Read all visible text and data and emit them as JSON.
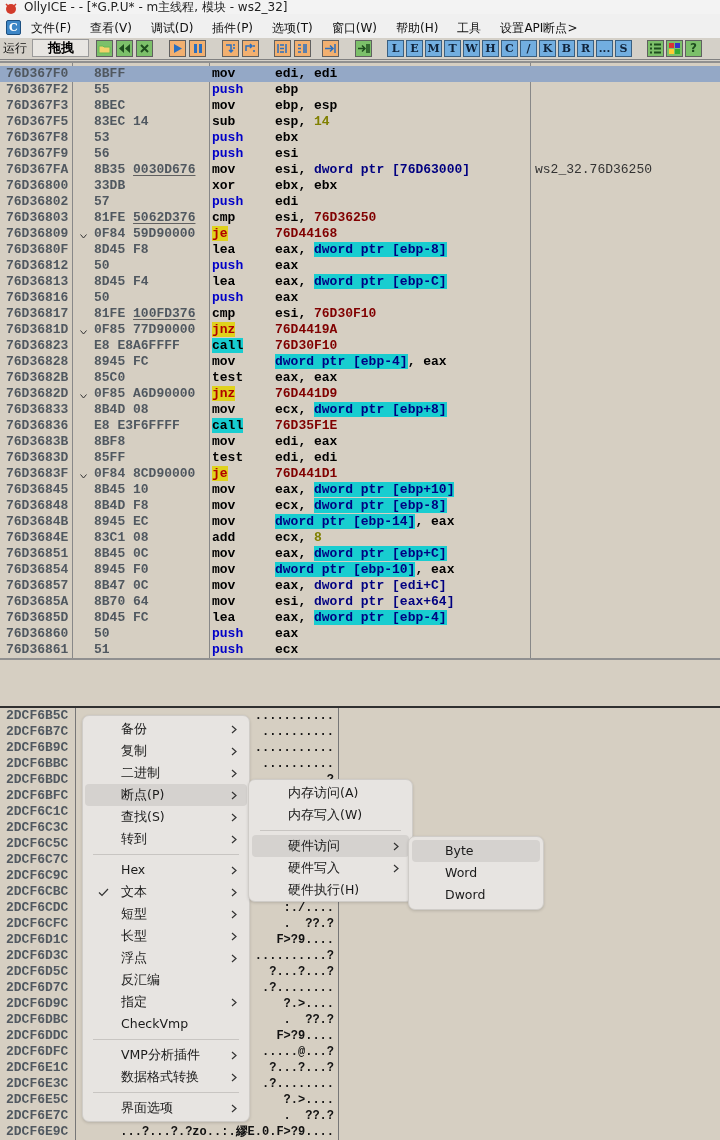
{
  "window": {
    "title": "OllyICE - - [*G.P.U* - m主线程, 模块 - ws2_32]"
  },
  "menubar": {
    "logo": "C",
    "items": [
      "文件(F)",
      "查看(V)",
      "调试(D)",
      "插件(P)",
      "选项(T)",
      "窗口(W)",
      "帮助(H)",
      "工具",
      "设置API断点>"
    ]
  },
  "toolbar": {
    "label": "运行",
    "field": "拖拽",
    "letter_buttons": [
      "L",
      "E",
      "M",
      "T",
      "W",
      "H",
      "C",
      "/",
      "K",
      "B",
      "R",
      "...",
      "S"
    ],
    "help_button": "?"
  },
  "disasm": {
    "rows": [
      {
        "address": "76D367F0",
        "hex": "8BFF",
        "jump": false,
        "selected": true,
        "mnemonic": "mov",
        "kind": "plain",
        "operands": [
          {
            "text": "edi",
            "kind": "reg"
          },
          {
            "text": ", ",
            "kind": "sep"
          },
          {
            "text": "edi",
            "kind": "reg"
          }
        ]
      },
      {
        "address": "76D367F2",
        "hex": "55",
        "jump": false,
        "selected": false,
        "mnemonic": "push",
        "kind": "push",
        "operands": [
          {
            "text": "ebp",
            "kind": "reg"
          }
        ]
      },
      {
        "address": "76D367F3",
        "hex": "8BEC",
        "jump": false,
        "selected": false,
        "mnemonic": "mov",
        "kind": "plain",
        "operands": [
          {
            "text": "ebp",
            "kind": "reg"
          },
          {
            "text": ", ",
            "kind": "sep"
          },
          {
            "text": "esp",
            "kind": "reg"
          }
        ]
      },
      {
        "address": "76D367F5",
        "hex": "83EC 14",
        "jump": false,
        "selected": false,
        "mnemonic": "sub",
        "kind": "plain",
        "operands": [
          {
            "text": "esp",
            "kind": "reg"
          },
          {
            "text": ", ",
            "kind": "sep"
          },
          {
            "text": "14",
            "kind": "imm"
          }
        ]
      },
      {
        "address": "76D367F8",
        "hex": "53",
        "jump": false,
        "selected": false,
        "mnemonic": "push",
        "kind": "push",
        "operands": [
          {
            "text": "ebx",
            "kind": "reg"
          }
        ]
      },
      {
        "address": "76D367F9",
        "hex": "56",
        "jump": false,
        "selected": false,
        "mnemonic": "push",
        "kind": "push",
        "operands": [
          {
            "text": "esi",
            "kind": "reg"
          }
        ]
      },
      {
        "address": "76D367FA",
        "hex": "8B35",
        "hex_fixup": "0030D676",
        "jump": false,
        "selected": false,
        "mnemonic": "mov",
        "kind": "plain",
        "operands": [
          {
            "text": "esi",
            "kind": "reg"
          },
          {
            "text": ", ",
            "kind": "sep"
          },
          {
            "text": "dword ptr [76D63000]",
            "kind": "mem"
          }
        ],
        "comment": "ws2_32.76D36250"
      },
      {
        "address": "76D36800",
        "hex": "33DB",
        "jump": false,
        "selected": false,
        "mnemonic": "xor",
        "kind": "plain",
        "operands": [
          {
            "text": "ebx",
            "kind": "reg"
          },
          {
            "text": ", ",
            "kind": "sep"
          },
          {
            "text": "ebx",
            "kind": "reg"
          }
        ]
      },
      {
        "address": "76D36802",
        "hex": "57",
        "jump": false,
        "selected": false,
        "mnemonic": "push",
        "kind": "push",
        "operands": [
          {
            "text": "edi",
            "kind": "reg"
          }
        ]
      },
      {
        "address": "76D36803",
        "hex": "81FE",
        "hex_fixup": "5062D376",
        "jump": false,
        "selected": false,
        "mnemonic": "cmp",
        "kind": "plain",
        "operands": [
          {
            "text": "esi",
            "kind": "reg"
          },
          {
            "text": ", ",
            "kind": "sep"
          },
          {
            "text": "76D36250",
            "kind": "addr"
          }
        ]
      },
      {
        "address": "76D36809",
        "hex": "0F84 59D90000",
        "jump": true,
        "selected": false,
        "mnemonic": "je",
        "kind": "jump",
        "operands": [
          {
            "text": "76D44168",
            "kind": "addr"
          }
        ]
      },
      {
        "address": "76D3680F",
        "hex": "8D45 F8",
        "jump": false,
        "selected": false,
        "mnemonic": "lea",
        "kind": "plain",
        "operands": [
          {
            "text": "eax",
            "kind": "reg"
          },
          {
            "text": ", ",
            "kind": "sep"
          },
          {
            "text": "dword ptr [ebp-8]",
            "kind": "stack"
          }
        ]
      },
      {
        "address": "76D36812",
        "hex": "50",
        "jump": false,
        "selected": false,
        "mnemonic": "push",
        "kind": "push",
        "operands": [
          {
            "text": "eax",
            "kind": "reg"
          }
        ]
      },
      {
        "address": "76D36813",
        "hex": "8D45 F4",
        "jump": false,
        "selected": false,
        "mnemonic": "lea",
        "kind": "plain",
        "operands": [
          {
            "text": "eax",
            "kind": "reg"
          },
          {
            "text": ", ",
            "kind": "sep"
          },
          {
            "text": "dword ptr [ebp-C]",
            "kind": "stack"
          }
        ]
      },
      {
        "address": "76D36816",
        "hex": "50",
        "jump": false,
        "selected": false,
        "mnemonic": "push",
        "kind": "push",
        "operands": [
          {
            "text": "eax",
            "kind": "reg"
          }
        ]
      },
      {
        "address": "76D36817",
        "hex": "81FE",
        "hex_fixup": "100FD376",
        "jump": false,
        "selected": false,
        "mnemonic": "cmp",
        "kind": "plain",
        "operands": [
          {
            "text": "esi",
            "kind": "reg"
          },
          {
            "text": ", ",
            "kind": "sep"
          },
          {
            "text": "76D30F10",
            "kind": "addr"
          }
        ]
      },
      {
        "address": "76D3681D",
        "hex": "0F85 77D90000",
        "jump": true,
        "selected": false,
        "mnemonic": "jnz",
        "kind": "jump",
        "operands": [
          {
            "text": "76D4419A",
            "kind": "addr"
          }
        ]
      },
      {
        "address": "76D36823",
        "hex": "E8 E8A6FFFF",
        "jump": false,
        "selected": false,
        "mnemonic": "call",
        "kind": "call",
        "operands": [
          {
            "text": "76D30F10",
            "kind": "addr"
          }
        ]
      },
      {
        "address": "76D36828",
        "hex": "8945 FC",
        "jump": false,
        "selected": false,
        "mnemonic": "mov",
        "kind": "plain",
        "operands": [
          {
            "text": "dword ptr [ebp-4]",
            "kind": "stack"
          },
          {
            "text": ", ",
            "kind": "sep"
          },
          {
            "text": "eax",
            "kind": "reg"
          }
        ]
      },
      {
        "address": "76D3682B",
        "hex": "85C0",
        "jump": false,
        "selected": false,
        "mnemonic": "test",
        "kind": "plain",
        "operands": [
          {
            "text": "eax",
            "kind": "reg"
          },
          {
            "text": ", ",
            "kind": "sep"
          },
          {
            "text": "eax",
            "kind": "reg"
          }
        ]
      },
      {
        "address": "76D3682D",
        "hex": "0F85 A6D90000",
        "jump": true,
        "selected": false,
        "mnemonic": "jnz",
        "kind": "jump",
        "operands": [
          {
            "text": "76D441D9",
            "kind": "addr"
          }
        ]
      },
      {
        "address": "76D36833",
        "hex": "8B4D 08",
        "jump": false,
        "selected": false,
        "mnemonic": "mov",
        "kind": "plain",
        "operands": [
          {
            "text": "ecx",
            "kind": "reg"
          },
          {
            "text": ", ",
            "kind": "sep"
          },
          {
            "text": "dword ptr [ebp+8]",
            "kind": "stack"
          }
        ]
      },
      {
        "address": "76D36836",
        "hex": "E8 E3F6FFFF",
        "jump": false,
        "selected": false,
        "mnemonic": "call",
        "kind": "call",
        "operands": [
          {
            "text": "76D35F1E",
            "kind": "addr"
          }
        ]
      },
      {
        "address": "76D3683B",
        "hex": "8BF8",
        "jump": false,
        "selected": false,
        "mnemonic": "mov",
        "kind": "plain",
        "operands": [
          {
            "text": "edi",
            "kind": "reg"
          },
          {
            "text": ", ",
            "kind": "sep"
          },
          {
            "text": "eax",
            "kind": "reg"
          }
        ]
      },
      {
        "address": "76D3683D",
        "hex": "85FF",
        "jump": false,
        "selected": false,
        "mnemonic": "test",
        "kind": "plain",
        "operands": [
          {
            "text": "edi",
            "kind": "reg"
          },
          {
            "text": ", ",
            "kind": "sep"
          },
          {
            "text": "edi",
            "kind": "reg"
          }
        ]
      },
      {
        "address": "76D3683F",
        "hex": "0F84 8CD90000",
        "jump": true,
        "selected": false,
        "mnemonic": "je",
        "kind": "jump",
        "operands": [
          {
            "text": "76D441D1",
            "kind": "addr"
          }
        ]
      },
      {
        "address": "76D36845",
        "hex": "8B45 10",
        "jump": false,
        "selected": false,
        "mnemonic": "mov",
        "kind": "plain",
        "operands": [
          {
            "text": "eax",
            "kind": "reg"
          },
          {
            "text": ", ",
            "kind": "sep"
          },
          {
            "text": "dword ptr [ebp+10]",
            "kind": "stack"
          }
        ]
      },
      {
        "address": "76D36848",
        "hex": "8B4D F8",
        "jump": false,
        "selected": false,
        "mnemonic": "mov",
        "kind": "plain",
        "operands": [
          {
            "text": "ecx",
            "kind": "reg"
          },
          {
            "text": ", ",
            "kind": "sep"
          },
          {
            "text": "dword ptr [ebp-8]",
            "kind": "stack"
          }
        ]
      },
      {
        "address": "76D3684B",
        "hex": "8945 EC",
        "jump": false,
        "selected": false,
        "mnemonic": "mov",
        "kind": "plain",
        "operands": [
          {
            "text": "dword ptr [ebp-14]",
            "kind": "stack"
          },
          {
            "text": ", ",
            "kind": "sep"
          },
          {
            "text": "eax",
            "kind": "reg"
          }
        ]
      },
      {
        "address": "76D3684E",
        "hex": "83C1 08",
        "jump": false,
        "selected": false,
        "mnemonic": "add",
        "kind": "plain",
        "operands": [
          {
            "text": "ecx",
            "kind": "reg"
          },
          {
            "text": ", ",
            "kind": "sep"
          },
          {
            "text": "8",
            "kind": "imm"
          }
        ]
      },
      {
        "address": "76D36851",
        "hex": "8B45 0C",
        "jump": false,
        "selected": false,
        "mnemonic": "mov",
        "kind": "plain",
        "operands": [
          {
            "text": "eax",
            "kind": "reg"
          },
          {
            "text": ", ",
            "kind": "sep"
          },
          {
            "text": "dword ptr [ebp+C]",
            "kind": "stack"
          }
        ]
      },
      {
        "address": "76D36854",
        "hex": "8945 F0",
        "jump": false,
        "selected": false,
        "mnemonic": "mov",
        "kind": "plain",
        "operands": [
          {
            "text": "dword ptr [ebp-10]",
            "kind": "stack"
          },
          {
            "text": ", ",
            "kind": "sep"
          },
          {
            "text": "eax",
            "kind": "reg"
          }
        ]
      },
      {
        "address": "76D36857",
        "hex": "8B47 0C",
        "jump": false,
        "selected": false,
        "mnemonic": "mov",
        "kind": "plain",
        "operands": [
          {
            "text": "eax",
            "kind": "reg"
          },
          {
            "text": ", ",
            "kind": "sep"
          },
          {
            "text": "dword ptr [edi+C]",
            "kind": "mem"
          }
        ]
      },
      {
        "address": "76D3685A",
        "hex": "8B70 64",
        "jump": false,
        "selected": false,
        "mnemonic": "mov",
        "kind": "plain",
        "operands": [
          {
            "text": "esi",
            "kind": "reg"
          },
          {
            "text": ", ",
            "kind": "sep"
          },
          {
            "text": "dword ptr [eax+64]",
            "kind": "mem"
          }
        ]
      },
      {
        "address": "76D3685D",
        "hex": "8D45 FC",
        "jump": false,
        "selected": false,
        "mnemonic": "lea",
        "kind": "plain",
        "operands": [
          {
            "text": "eax",
            "kind": "reg"
          },
          {
            "text": ", ",
            "kind": "sep"
          },
          {
            "text": "dword ptr [ebp-4]",
            "kind": "stack"
          }
        ]
      },
      {
        "address": "76D36860",
        "hex": "50",
        "jump": false,
        "selected": false,
        "mnemonic": "push",
        "kind": "push",
        "operands": [
          {
            "text": "eax",
            "kind": "reg"
          }
        ]
      },
      {
        "address": "76D36861",
        "hex": "51",
        "jump": false,
        "selected": false,
        "mnemonic": "push",
        "kind": "push",
        "operands": [
          {
            "text": "ecx",
            "kind": "reg"
          }
        ]
      }
    ]
  },
  "dump": {
    "rows": [
      {
        "address": "2DCF6B5C",
        "text": "..........."
      },
      {
        "address": "2DCF6B7C",
        "text": ".........."
      },
      {
        "address": "2DCF6B9C",
        "text": "..........."
      },
      {
        "address": "2DCF6BBC",
        "text": ".........."
      },
      {
        "address": "2DCF6BDC",
        "text": "?"
      },
      {
        "address": "2DCF6BFC"
      },
      {
        "address": "2DCF6C1C"
      },
      {
        "address": "2DCF6C3C"
      },
      {
        "address": "2DCF6C5C"
      },
      {
        "address": "2DCF6C7C"
      },
      {
        "address": "2DCF6C9C"
      },
      {
        "address": "2DCF6CBC"
      },
      {
        "address": "2DCF6CDC",
        "text": ":./...."
      },
      {
        "address": "2DCF6CFC",
        "text": ".  ??.?"
      },
      {
        "address": "2DCF6D1C",
        "text": "F>?9...."
      },
      {
        "address": "2DCF6D3C",
        "text": "..........?"
      },
      {
        "address": "2DCF6D5C",
        "text": "?...?...?"
      },
      {
        "address": "2DCF6D7C",
        "text": ".?........"
      },
      {
        "address": "2DCF6D9C",
        "text": "?.>...."
      },
      {
        "address": "2DCF6DBC",
        "text": ".  ??.?"
      },
      {
        "address": "2DCF6DDC",
        "text": "F>?9...."
      },
      {
        "address": "2DCF6DFC",
        "text": ".....@...?"
      },
      {
        "address": "2DCF6E1C",
        "text": "?...?...?"
      },
      {
        "address": "2DCF6E3C",
        "text": ".?........"
      },
      {
        "address": "2DCF6E5C",
        "text": "?.>...."
      },
      {
        "address": "2DCF6E7C",
        "text": ".  ??.?"
      },
      {
        "address": "2DCF6E9C",
        "text": "...?...?.?zo..:.繆E.0.F>?9...."
      }
    ]
  },
  "context_menu": {
    "items": [
      {
        "kind": "item",
        "label": "备份",
        "submenu": true,
        "checked": false,
        "selected": false
      },
      {
        "kind": "item",
        "label": "复制",
        "submenu": true,
        "checked": false,
        "selected": false
      },
      {
        "kind": "item",
        "label": "二进制",
        "submenu": true,
        "checked": false,
        "selected": false
      },
      {
        "kind": "item",
        "label": "断点(P)",
        "submenu": true,
        "checked": false,
        "selected": true
      },
      {
        "kind": "item",
        "label": "查找(S)",
        "submenu": true,
        "checked": false,
        "selected": false
      },
      {
        "kind": "item",
        "label": "转到",
        "submenu": true,
        "checked": false,
        "selected": false
      },
      {
        "kind": "separator"
      },
      {
        "kind": "item",
        "label": "Hex",
        "submenu": true,
        "checked": false,
        "selected": false
      },
      {
        "kind": "item",
        "label": "文本",
        "submenu": true,
        "checked": true,
        "selected": false
      },
      {
        "kind": "item",
        "label": "短型",
        "submenu": true,
        "checked": false,
        "selected": false
      },
      {
        "kind": "item",
        "label": "长型",
        "submenu": true,
        "checked": false,
        "selected": false
      },
      {
        "kind": "item",
        "label": "浮点",
        "submenu": true,
        "checked": false,
        "selected": false
      },
      {
        "kind": "item",
        "label": "反汇编",
        "submenu": false,
        "checked": false,
        "selected": false
      },
      {
        "kind": "item",
        "label": "指定",
        "submenu": true,
        "checked": false,
        "selected": false
      },
      {
        "kind": "item",
        "label": "CheckVmp",
        "submenu": false,
        "checked": false,
        "selected": false
      },
      {
        "kind": "separator"
      },
      {
        "kind": "item",
        "label": "VMP分析插件",
        "submenu": true,
        "checked": false,
        "selected": false
      },
      {
        "kind": "item",
        "label": "数据格式转换",
        "submenu": true,
        "checked": false,
        "selected": false
      },
      {
        "kind": "separator"
      },
      {
        "kind": "item",
        "label": "界面选项",
        "submenu": true,
        "checked": false,
        "selected": false
      }
    ]
  },
  "breakpoint_submenu": {
    "items": [
      {
        "kind": "item",
        "label": "内存访问(A)",
        "submenu": false,
        "selected": false
      },
      {
        "kind": "item",
        "label": "内存写入(W)",
        "submenu": false,
        "selected": false
      },
      {
        "kind": "separator"
      },
      {
        "kind": "item",
        "label": "硬件访问",
        "submenu": true,
        "selected": true
      },
      {
        "kind": "item",
        "label": "硬件写入",
        "submenu": true,
        "selected": false
      },
      {
        "kind": "item",
        "label": "硬件执行(H)",
        "submenu": false,
        "selected": false
      }
    ]
  },
  "size_submenu": {
    "items": [
      {
        "label": "Byte",
        "selected": true
      },
      {
        "label": "Word",
        "selected": false
      },
      {
        "label": "Dword",
        "selected": false
      }
    ]
  }
}
